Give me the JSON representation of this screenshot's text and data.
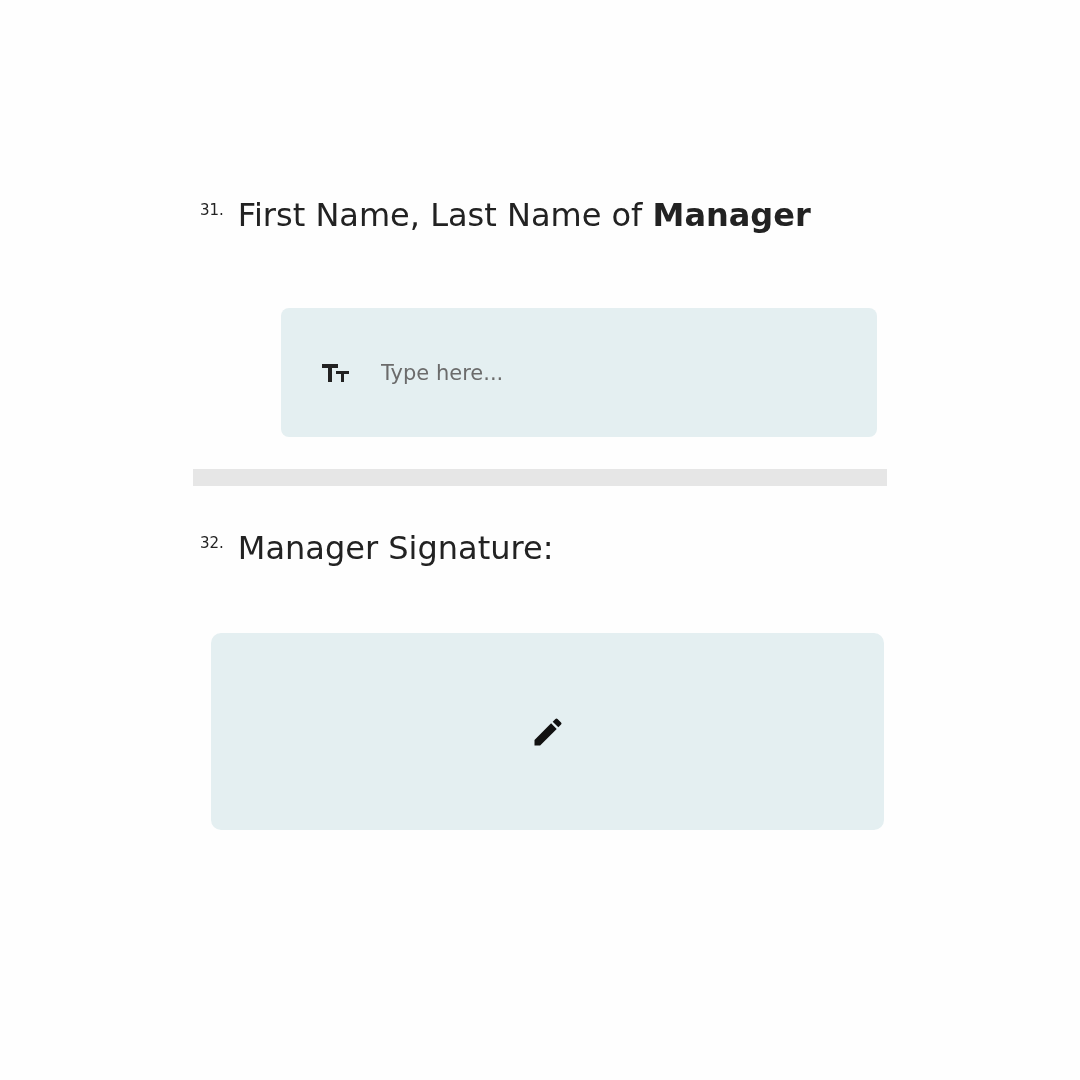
{
  "questions": [
    {
      "kind": "text",
      "number": "31.",
      "label": "First Name, Last Name of **Manager**",
      "placeholder": "Type here..."
    },
    {
      "kind": "signature",
      "number": "32.",
      "label": "Manager Signature:"
    }
  ]
}
